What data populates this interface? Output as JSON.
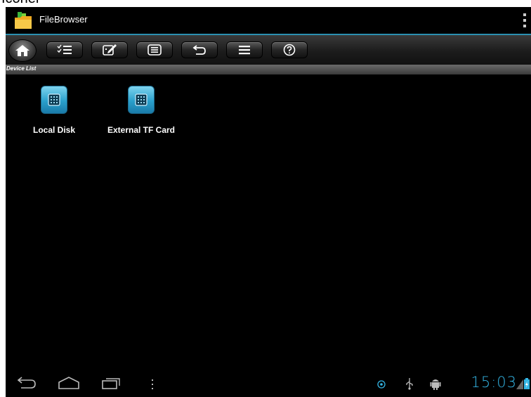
{
  "caption": "Iconer",
  "app": {
    "title": "FileBrowser",
    "icon": "folder-app-icon"
  },
  "toolbar": {
    "buttons": [
      {
        "name": "home-button",
        "icon": "home-icon"
      },
      {
        "name": "select-button",
        "icon": "checklist-icon"
      },
      {
        "name": "edit-button",
        "icon": "edit-icon"
      },
      {
        "name": "list-view-button",
        "icon": "list-view-icon"
      },
      {
        "name": "back-button",
        "icon": "undo-icon"
      },
      {
        "name": "menu-button",
        "icon": "menu-icon"
      },
      {
        "name": "help-button",
        "icon": "help-icon"
      }
    ]
  },
  "section": {
    "title": "Device List"
  },
  "devices": [
    {
      "label": "Local Disk",
      "icon": "sd-card-icon"
    },
    {
      "label": "External TF Card",
      "icon": "sd-card-icon"
    }
  ],
  "status": {
    "time": "15:03"
  },
  "colors": {
    "accent": "#33b5e5",
    "actionbar_divider": "#2a8fb0",
    "device_icon": "#2aa0cc"
  }
}
